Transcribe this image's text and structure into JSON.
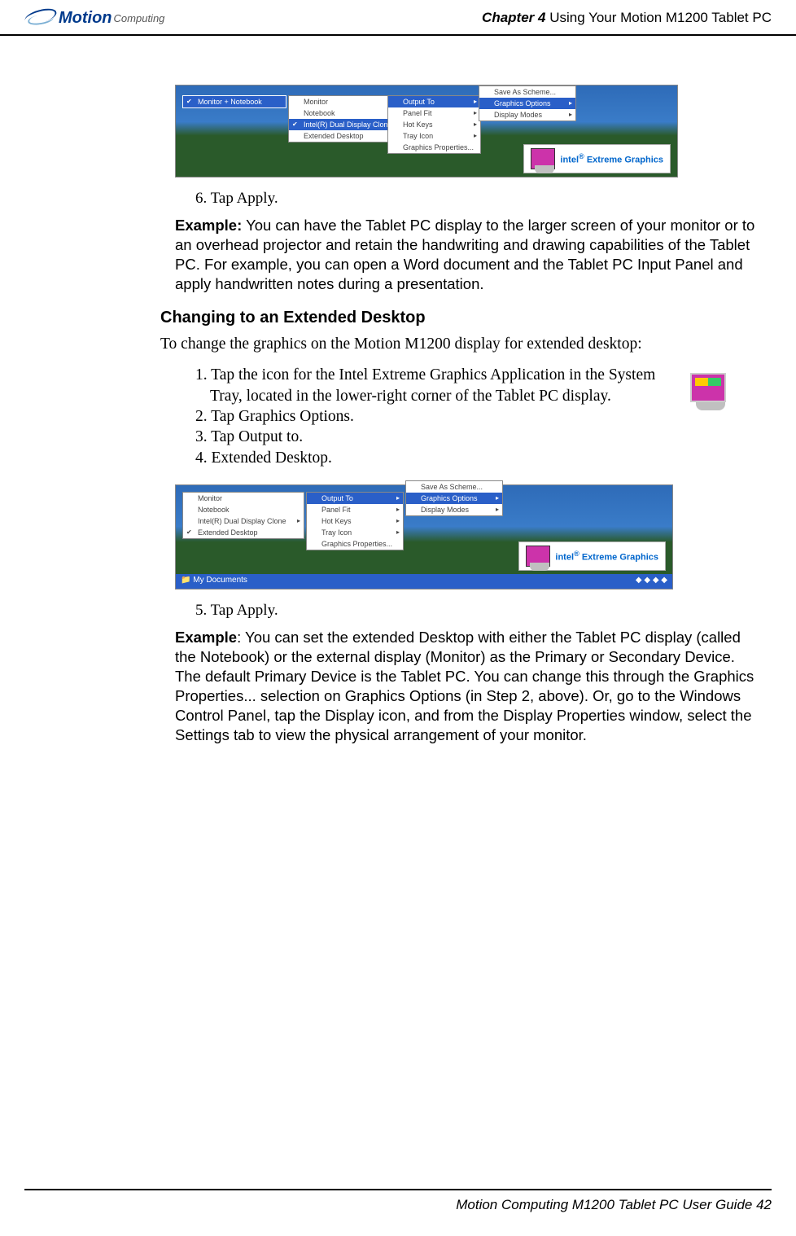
{
  "header": {
    "logo_main": "Motion",
    "logo_sub": "Computing",
    "chapter_bold": "Chapter 4",
    "chapter_rest": " Using Your Motion M1200 Tablet PC"
  },
  "screenshot1": {
    "menu1_item": "Monitor + Notebook",
    "menu2": [
      "Monitor",
      "Notebook",
      "Intel(R) Dual Display Clone",
      "Extended Desktop"
    ],
    "menu3": [
      "Output To",
      "Panel Fit",
      "Hot Keys",
      "Tray Icon",
      "Graphics Properties..."
    ],
    "menu4": [
      "Save As Scheme...",
      "Graphics Options",
      "Display Modes"
    ],
    "intel_label_1": "intel",
    "intel_label_2": "Extreme Graphics"
  },
  "step6": "6. Tap Apply.",
  "example1_bold": "Example:",
  "example1_text": " You can have the Tablet PC display to the larger screen of your monitor or to an overhead projector and retain the handwriting and drawing capabilities of the Tablet PC. For example, you can open a Word document and the Tablet PC Input Panel and apply handwritten notes during a presentation.",
  "heading2": "Changing to an Extended Desktop",
  "intro2": "To change the graphics on the Motion M1200 display for extended desktop:",
  "steps2": {
    "s1": "1. Tap the icon for the Intel Extreme Graphics Application in the System Tray, located in the lower-right corner of the Tablet PC display.",
    "s2": "2. Tap Graphics Options.",
    "s3": "3. Tap Output to.",
    "s4": "4. Extended Desktop."
  },
  "screenshot2": {
    "menu1": [
      "Monitor",
      "Notebook",
      "Intel(R) Dual Display Clone",
      "Extended Desktop"
    ],
    "menu2": [
      "Output To",
      "Panel Fit",
      "Hot Keys",
      "Tray Icon",
      "Graphics Properties..."
    ],
    "menu3": [
      "Save As Scheme...",
      "Graphics Options",
      "Display Modes"
    ],
    "taskbar_left": "My Documents",
    "intel_label_1": "intel",
    "intel_label_2": "Extreme Graphics"
  },
  "step5": "5. Tap Apply.",
  "example2_bold": "Example",
  "example2_text": ": You can set the extended Desktop with either the Tablet PC display (called the Notebook) or the external display (Monitor) as the Primary or Secondary Device. The default Primary Device is the Tablet PC. You can change this through the Graphics Properties... selection on Graphics Options (in Step 2, above). Or, go to the Windows Control Panel, tap the Display icon, and from the Display Properties window, select the Settings tab to view the physical arrangement of your monitor.",
  "footer_text": "Motion Computing M1200 Tablet PC User Guide ",
  "footer_page": "42"
}
